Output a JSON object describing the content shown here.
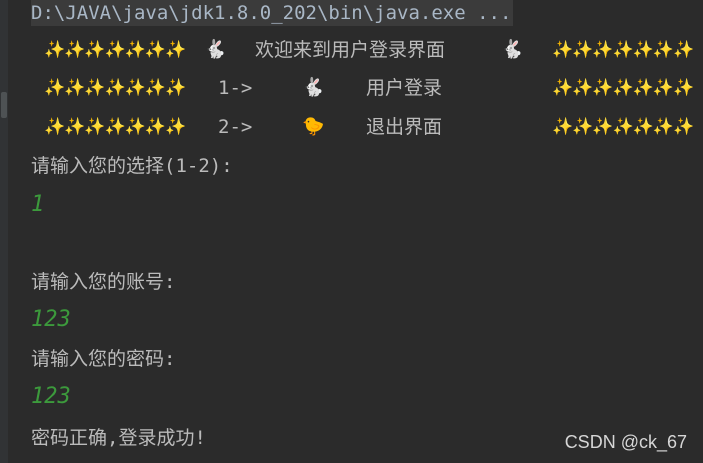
{
  "console": {
    "command": "D:\\JAVA\\java\\jdk1.8.0_202\\bin\\java.exe ...",
    "banner": [
      {
        "left": "✨✨✨✨✨✨✨",
        "icon": "🐇",
        "label": "欢迎来到用户登录界面",
        "icon2": "🐇",
        "right": "✨✨✨✨✨✨✨"
      },
      {
        "left": "✨✨✨✨✨✨✨",
        "option": "1->",
        "icon": "🐇",
        "label": "用户登录",
        "right": "✨✨✨✨✨✨✨"
      },
      {
        "left": "✨✨✨✨✨✨✨",
        "option": "2->",
        "icon": "🐤",
        "label": "退出界面",
        "right": "✨✨✨✨✨✨✨"
      }
    ],
    "prompt_choice": "请输入您的选择(1-2):",
    "input_choice": "1",
    "prompt_account": "请输入您的账号:",
    "input_account": "123",
    "prompt_password": "请输入您的密码:",
    "input_password": "123",
    "result": "密码正确,登录成功!"
  },
  "watermark": "CSDN @ck_67"
}
